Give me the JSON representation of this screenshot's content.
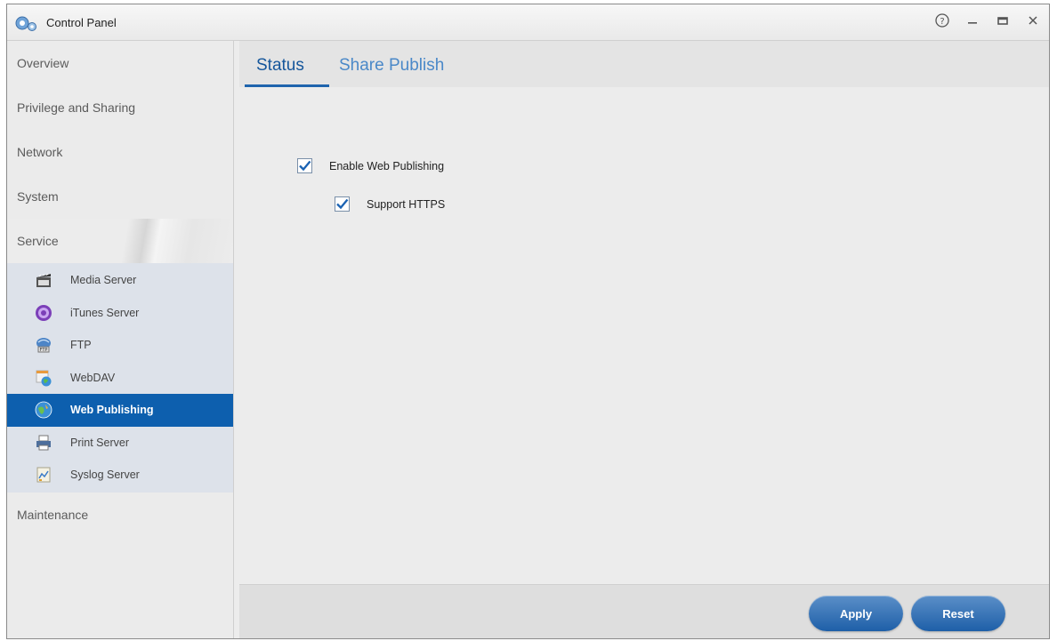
{
  "window": {
    "title": "Control Panel"
  },
  "sidebar": {
    "items": [
      {
        "label": "Overview"
      },
      {
        "label": "Privilege and Sharing"
      },
      {
        "label": "Network"
      },
      {
        "label": "System"
      },
      {
        "label": "Service"
      },
      {
        "label": "Maintenance"
      }
    ],
    "service_items": [
      {
        "label": "Media Server",
        "icon": "media-server-icon"
      },
      {
        "label": "iTunes Server",
        "icon": "itunes-icon"
      },
      {
        "label": "FTP",
        "icon": "ftp-icon"
      },
      {
        "label": "WebDAV",
        "icon": "webdav-icon"
      },
      {
        "label": "Web Publishing",
        "icon": "web-publishing-icon",
        "active": true
      },
      {
        "label": "Print Server",
        "icon": "printer-icon"
      },
      {
        "label": "Syslog Server",
        "icon": "syslog-icon"
      }
    ]
  },
  "tabs": [
    {
      "label": "Status",
      "active": true
    },
    {
      "label": "Share Publish",
      "active": false
    }
  ],
  "form": {
    "enable_web_publishing": {
      "label": "Enable Web Publishing",
      "checked": true
    },
    "support_https": {
      "label": "Support HTTPS",
      "checked": true
    }
  },
  "footer": {
    "apply_label": "Apply",
    "reset_label": "Reset"
  },
  "colors": {
    "accent": "#0d5fae",
    "tab_active": "#15569b",
    "tab_inactive": "#4a88c8"
  }
}
